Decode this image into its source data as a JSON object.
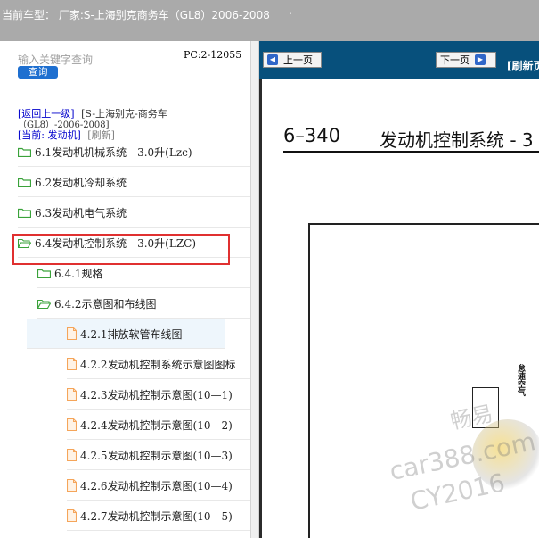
{
  "header": {
    "vehicle_label": "当前车型： 厂家:S-上海别克商务车（GL8）2006-2008",
    "trailing_mark": "."
  },
  "search": {
    "placeholder": "输入关键字查询",
    "button_label": "查询",
    "pc_code": "PC:2-12055"
  },
  "nav": {
    "back_link": "[返回上一级]",
    "breadcrumb_line1": "[S-上海别克-商务车",
    "breadcrumb_line2": "（GL8）-2006-2008]",
    "current_label": "[当前: 发动机]",
    "refresh_label": "[刷新]"
  },
  "tree": {
    "items": [
      {
        "label": "6.1发动机机械系统—3.0升(Lzc)",
        "type": "folder"
      },
      {
        "label": "6.2发动机冷却系统",
        "type": "folder"
      },
      {
        "label": "6.3发动机电气系统",
        "type": "folder"
      },
      {
        "label": "6.4发动机控制系统—3.0升(LZC)",
        "type": "folder-open"
      },
      {
        "label": "6.4.1规格",
        "type": "folder"
      },
      {
        "label": "6.4.2示意图和布线图",
        "type": "folder-open"
      },
      {
        "label": "4.2.1排放软管布线图",
        "type": "doc"
      },
      {
        "label": "4.2.2发动机控制系统示意图图标",
        "type": "doc"
      },
      {
        "label": "4.2.3发动机控制示意图(10—1)",
        "type": "doc"
      },
      {
        "label": "4.2.4发动机控制示意图(10—2)",
        "type": "doc"
      },
      {
        "label": "4.2.5发动机控制示意图(10—3)",
        "type": "doc"
      },
      {
        "label": "4.2.6发动机控制示意图(10—4)",
        "type": "doc"
      },
      {
        "label": "4.2.7发动机控制示意图(10—5)",
        "type": "doc"
      }
    ]
  },
  "viewer": {
    "prev_label": "上一页",
    "next_label": "下一页",
    "refresh_label": "[刷新页",
    "page_number": "6–340",
    "page_title": "发动机控制系统 - 3",
    "diagram_label": "怠速空气"
  },
  "watermark": {
    "line1": "畅易",
    "line2": "car388.com",
    "line3": "CY2016"
  },
  "colors": {
    "topbar": "#aaaaaa",
    "toolbar": "#07507c",
    "button_blue": "#1e6fd0",
    "highlight": "#e03030",
    "folder_green": "#3aa23a",
    "doc_orange": "#f5a55a"
  }
}
